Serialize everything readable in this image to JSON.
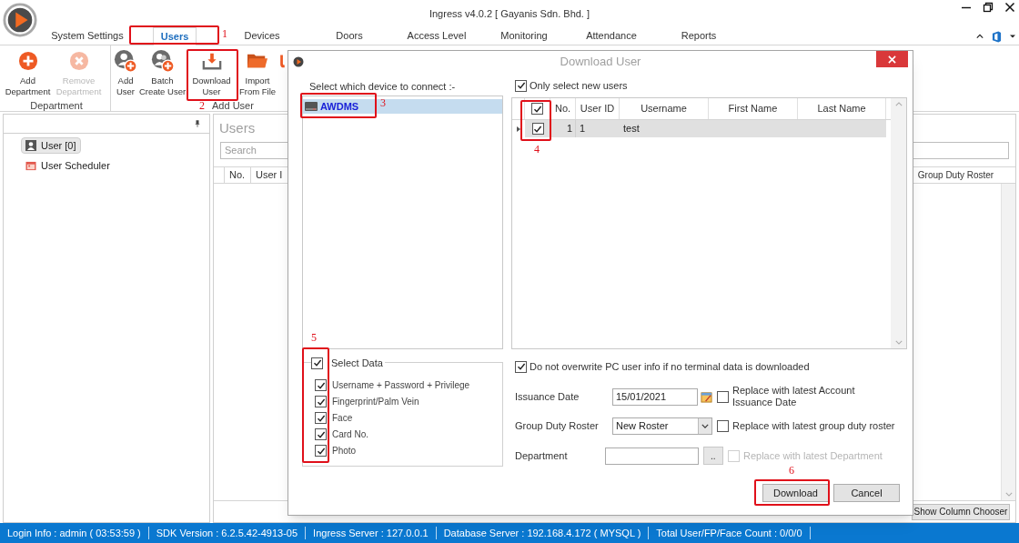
{
  "window": {
    "title": "Ingress v4.0.2 [ Gayanis Sdn. Bhd. ]"
  },
  "tabs": [
    {
      "label": "System Settings",
      "selected": false
    },
    {
      "label": "Users",
      "selected": true
    },
    {
      "label": "Devices",
      "selected": false
    },
    {
      "label": "Doors",
      "selected": false
    },
    {
      "label": "Access Level",
      "selected": false
    },
    {
      "label": "Monitoring",
      "selected": false
    },
    {
      "label": "Attendance",
      "selected": false
    },
    {
      "label": "Reports",
      "selected": false
    }
  ],
  "ribbon": {
    "groups": [
      {
        "label": "Department",
        "buttons": [
          {
            "kind": "add",
            "lines": [
              "Add",
              "Department"
            ],
            "disabled": false
          },
          {
            "kind": "remove",
            "lines": [
              "Remove",
              "Department"
            ],
            "disabled": true
          }
        ]
      },
      {
        "label": "Add User",
        "buttons": [
          {
            "kind": "add-user",
            "lines": [
              "Add",
              "User"
            ],
            "disabled": false
          },
          {
            "kind": "batch-user",
            "lines": [
              "Batch",
              "Create User"
            ],
            "disabled": false
          },
          {
            "kind": "download",
            "lines": [
              "Download",
              "User"
            ],
            "disabled": false
          },
          {
            "kind": "folder",
            "lines": [
              "Import",
              "From File"
            ],
            "disabled": false
          },
          {
            "kind": "partial",
            "disabled": false
          }
        ]
      }
    ]
  },
  "nav": {
    "items": [
      {
        "kind": "user",
        "label": "User [0]",
        "selected": true
      },
      {
        "kind": "scheduler",
        "label": "User Scheduler",
        "selected": false
      }
    ]
  },
  "users_panel": {
    "title": "Users",
    "search": {
      "placeholder": "Search"
    },
    "columns_left": [
      "No.",
      "User I"
    ],
    "columns_right": [
      "Group Duty Roster"
    ],
    "column_chooser": "Show Column Chooser"
  },
  "dialog": {
    "title": "Download User",
    "device_prompt": "Select which device to connect :-",
    "devices": [
      {
        "label": "AWDMS",
        "selected": true
      }
    ],
    "select_data": {
      "label": "Select Data",
      "checked": true,
      "items": [
        {
          "label": "Username + Password + Privilege",
          "checked": true
        },
        {
          "label": "Fingerprint/Palm Vein",
          "checked": true
        },
        {
          "label": "Face",
          "checked": true
        },
        {
          "label": "Card No.",
          "checked": true
        },
        {
          "label": "Photo",
          "checked": true
        }
      ]
    },
    "only_new": {
      "label": "Only select new users",
      "checked": true
    },
    "grid": {
      "header_checked": true,
      "columns": [
        "No.",
        "User ID",
        "Username",
        "First Name",
        "Last Name"
      ],
      "rows": [
        {
          "checked": true,
          "no": "1",
          "user_id": "1",
          "username": "test"
        }
      ]
    },
    "no_overwrite": {
      "label": "Do not overwrite PC user info if no terminal data is downloaded",
      "checked": true
    },
    "issuance": {
      "label": "Issuance Date",
      "value": "15/01/2021",
      "replace_label": "Replace with latest Account Issuance Date",
      "replace_checked": false
    },
    "roster": {
      "label": "Group Duty Roster",
      "value": "New Roster",
      "replace_label": "Replace with latest group duty roster",
      "replace_checked": false
    },
    "department": {
      "label": "Department",
      "browse": "..",
      "replace_label": "Replace with latest Department",
      "replace_checked": false,
      "replace_disabled": true
    },
    "buttons": [
      "Download",
      "Cancel"
    ]
  },
  "status_bar": [
    "Login Info : admin ( 03:53:59 )",
    "SDK Version : 6.2.5.42-4913-05",
    "Ingress Server : 127.0.0.1",
    "Database Server : 192.168.4.172 ( MYSQL )",
    "Total User/FP/Face Count : 0/0/0"
  ],
  "annotations": [
    {
      "label": "1"
    },
    {
      "label": "2"
    },
    {
      "label": "3"
    },
    {
      "label": "4"
    },
    {
      "label": "5"
    },
    {
      "label": "6"
    }
  ]
}
